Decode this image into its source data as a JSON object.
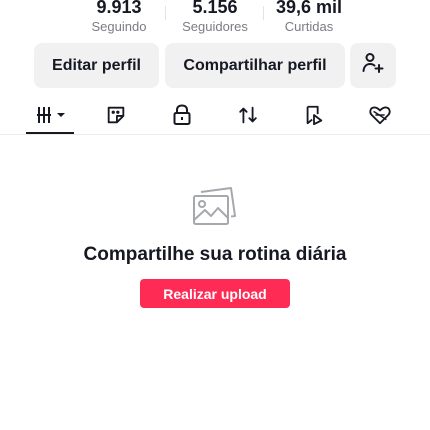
{
  "stats": [
    {
      "value": "9.913",
      "label": "Seguindo"
    },
    {
      "value": "5.156",
      "label": "Seguidores"
    },
    {
      "value": "39,6 mil",
      "label": "Curtidas"
    }
  ],
  "actions": {
    "edit_label": "Editar perfil",
    "share_label": "Compartilhar perfil",
    "add_friend_icon": "add-user-icon"
  },
  "tabs": [
    {
      "icon": "grid-icon",
      "active": true
    },
    {
      "icon": "sticker-icon"
    },
    {
      "icon": "lock-icon"
    },
    {
      "icon": "repost-icon"
    },
    {
      "icon": "bookmark-icon"
    },
    {
      "icon": "heart-icon"
    }
  ],
  "empty_state": {
    "icon": "photo-gallery-icon",
    "title": "Compartilhe sua rotina diária",
    "button_label": "Realizar upload"
  },
  "colors": {
    "accent": "#fe2c55",
    "text": "#161823",
    "muted": "#7a7c85",
    "button_bg": "#f1f1f2"
  }
}
